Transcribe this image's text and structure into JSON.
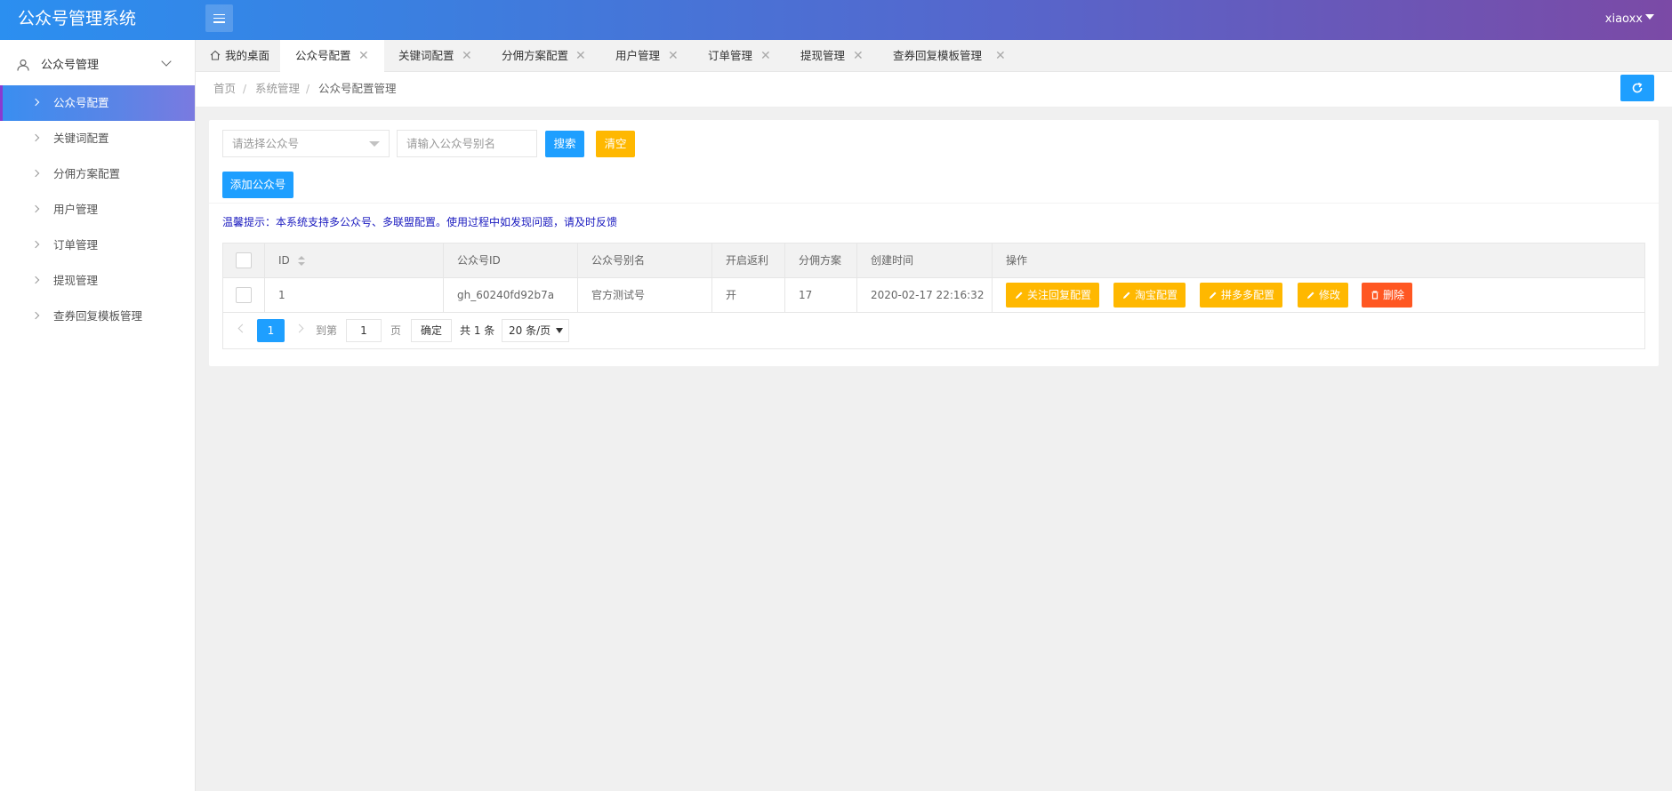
{
  "app": {
    "title": "公众号管理系统",
    "user": "xiaoxx"
  },
  "sidebar": {
    "group_label": "公众号管理",
    "items": [
      {
        "label": "公众号配置",
        "active": true
      },
      {
        "label": "关键词配置"
      },
      {
        "label": "分佣方案配置"
      },
      {
        "label": "用户管理"
      },
      {
        "label": "订单管理"
      },
      {
        "label": "提现管理"
      },
      {
        "label": "查券回复模板管理"
      }
    ]
  },
  "tabs": [
    {
      "label": "我的桌面"
    },
    {
      "label": "公众号配置",
      "active": true
    },
    {
      "label": "关键词配置"
    },
    {
      "label": "分佣方案配置"
    },
    {
      "label": "用户管理"
    },
    {
      "label": "订单管理"
    },
    {
      "label": "提现管理"
    },
    {
      "label": "查券回复模板管理"
    }
  ],
  "tab_close_glyph": "✕",
  "breadcrumb": {
    "items": [
      "首页",
      "系统管理",
      "公众号配置管理"
    ],
    "separator": "/"
  },
  "filters": {
    "select_placeholder": "请选择公众号",
    "alias_placeholder": "请输入公众号别名",
    "search_label": "搜索",
    "clear_label": "清空",
    "add_label": "添加公众号"
  },
  "tip": "温馨提示：本系统支持多公众号、多联盟配置。使用过程中如发现问题，请及时反馈",
  "table": {
    "columns": [
      "ID",
      "公众号ID",
      "公众号别名",
      "开启返利",
      "分佣方案",
      "创建时间",
      "操作"
    ],
    "rows": [
      {
        "id": "1",
        "account_id": "gh_60240fd92b7a",
        "alias": "官方测试号",
        "rebate": "开",
        "scheme": "17",
        "created": "2020-02-17 22:16:32",
        "actions": [
          "关注回复配置",
          "淘宝配置",
          "拼多多配置",
          "修改",
          "删除"
        ]
      }
    ]
  },
  "pagination": {
    "current_page": "1",
    "goto_label": "到第",
    "goto_value": "1",
    "page_unit": "页",
    "confirm_label": "确定",
    "total_label": "共 1 条",
    "page_size": "20 条/页"
  },
  "colors": {
    "primary": "#1e9fff",
    "warn": "#ffb800",
    "danger": "#ff5722",
    "header_start": "#2b8ff0",
    "header_end": "#7b4aa6"
  }
}
